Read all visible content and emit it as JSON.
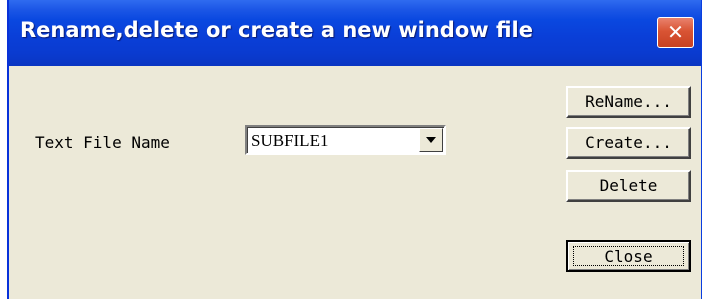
{
  "window": {
    "title": "Rename,delete or create a new window file",
    "close_glyph": "✕"
  },
  "form": {
    "file_name_label": "Text File Name",
    "file_name_value": "SUBFILE1"
  },
  "buttons": {
    "rename": "ReName...",
    "create": "Create...",
    "delete": "Delete",
    "close": "Close"
  },
  "colors": {
    "title_bar": "#0a48e0",
    "dialog_bg": "#ece9d8",
    "close_button": "#d95434"
  },
  "icons": {
    "close": "close-icon",
    "dropdown": "chevron-down-icon"
  }
}
